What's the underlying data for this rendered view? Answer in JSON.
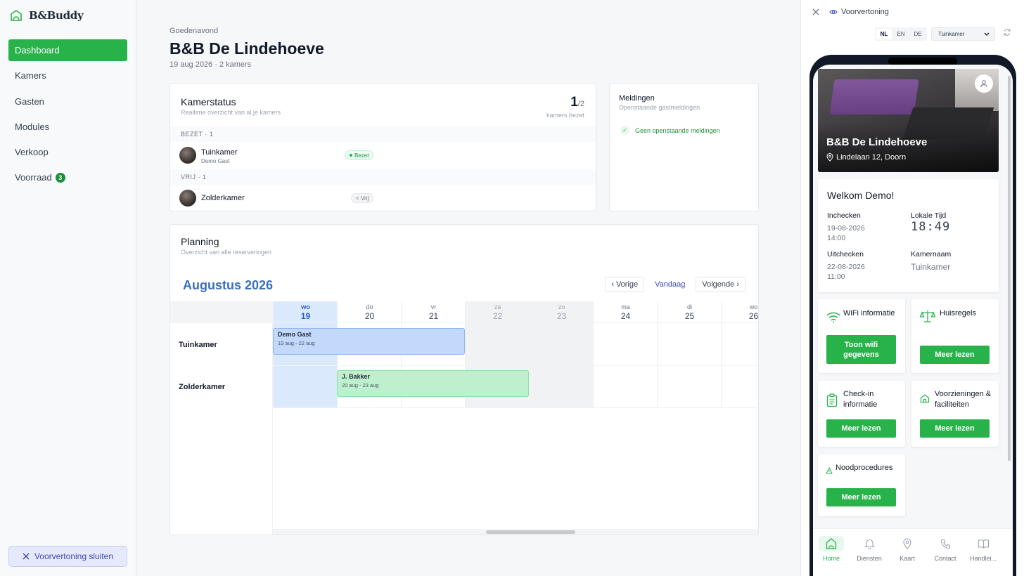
{
  "sidebar": {
    "brand": "B&Buddy",
    "items": [
      {
        "label": "Dashboard"
      },
      {
        "label": "Kamers"
      },
      {
        "label": "Gasten"
      },
      {
        "label": "Modules"
      },
      {
        "label": "Verkoop"
      },
      {
        "label": "Voorraad",
        "badge": "3"
      }
    ],
    "close_preview": "Voorvertoning sluiten"
  },
  "header": {
    "greeting": "Goedenavond",
    "title": "B&B De Lindehoeve",
    "subtitle": "19 aug 2026 · 2 kamers"
  },
  "kamerstatus": {
    "title": "Kamerstatus",
    "subtitle": "Realtime overzicht van al je kamers",
    "count_big": "1",
    "count_small": "/2",
    "count_label": "kamers bezet",
    "group_bezet": "BEZET · 1",
    "group_vrij": "VRIJ · 1",
    "rooms": [
      {
        "name": "Tuinkamer",
        "guest": "Demo Gast",
        "status": "Bezet"
      },
      {
        "name": "Zolderkamer",
        "guest": "",
        "status": "Vrij"
      }
    ]
  },
  "meldingen": {
    "title": "Meldingen",
    "subtitle": "Openstaande gastmeldingen",
    "empty": "Geen openstaande meldingen"
  },
  "planning": {
    "title": "Planning",
    "subtitle": "Overzicht van alle reserveringen",
    "month": "Augustus 2026",
    "prev": "‹ Vorige",
    "today": "Vandaag",
    "next": "Volgende ›",
    "days": [
      {
        "label": "wo",
        "num": "19"
      },
      {
        "label": "do",
        "num": "20"
      },
      {
        "label": "vr",
        "num": "21"
      },
      {
        "label": "za",
        "num": "22"
      },
      {
        "label": "zo",
        "num": "23"
      },
      {
        "label": "ma",
        "num": "24"
      },
      {
        "label": "di",
        "num": "25"
      },
      {
        "label": "wo",
        "num": "26"
      }
    ],
    "resources": [
      "Tuinkamer",
      "Zolderkamer"
    ],
    "events": [
      {
        "name": "Demo Gast",
        "dates": "19 aug - 22 aug"
      },
      {
        "name": "J. Bakker",
        "dates": "20 aug - 23 aug"
      }
    ]
  },
  "preview": {
    "title": "Voorvertoning",
    "langs": [
      "NL",
      "EN",
      "DE"
    ],
    "room_select": "Tuinkamer",
    "property_name": "B&B De Lindehoeve",
    "address": "Lindelaan 12, Doorn",
    "welcome": "Welkom Demo!",
    "checkin_label": "Inchecken",
    "checkin_date": "19-08-2026",
    "checkin_time": "14:00",
    "checkout_label": "Uitchecken",
    "checkout_date": "22-08-2026",
    "checkout_time": "11:00",
    "localtime_label": "Lokale Tijd",
    "localtime": "18:49",
    "roomname_label": "Kamernaam",
    "roomname": "Tuinkamer",
    "tiles": [
      {
        "label": "WiFi informatie",
        "button": "Toon wifi gegevens"
      },
      {
        "label": "Huisregels",
        "button": "Meer lezen"
      },
      {
        "label": "Check-in informatie",
        "button": "Meer lezen"
      },
      {
        "label": "Voorzieningen & faciliteiten",
        "button": "Meer lezen"
      },
      {
        "label": "Noodprocedures",
        "button": "Meer lezen"
      }
    ],
    "tabs": [
      "Home",
      "Diensten",
      "Kaart",
      "Contact",
      "Handlei..."
    ]
  }
}
